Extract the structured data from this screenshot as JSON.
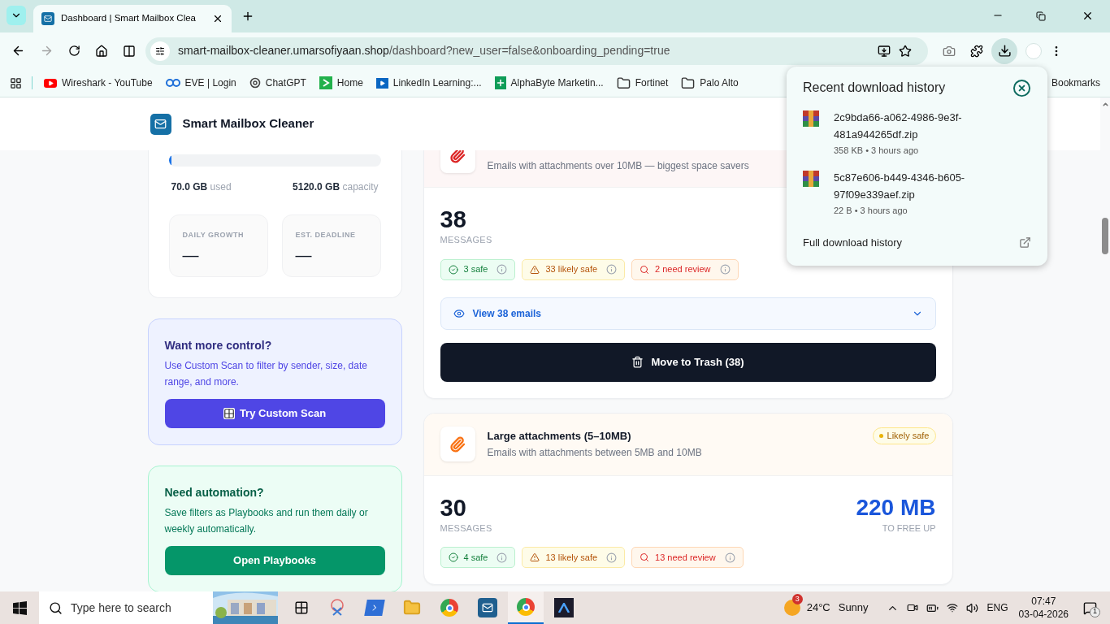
{
  "browser": {
    "tabs": [
      {
        "title": "Dashboard | Smart Mailbox Clea",
        "selected": true
      }
    ],
    "url_host": "smart-mailbox-cleaner.umarsofiyaan.shop",
    "url_path": "/dashboard?new_user=false&onboarding_pending=true",
    "bookmarks": [
      {
        "label": "Wireshark - YouTube",
        "kind": "youtube"
      },
      {
        "label": "EVE | Login",
        "kind": "eve"
      },
      {
        "label": "ChatGPT",
        "kind": "chatgpt"
      },
      {
        "label": "Home",
        "kind": "home"
      },
      {
        "label": "LinkedIn Learning:...",
        "kind": "linkedin"
      },
      {
        "label": "AlphaByte Marketin...",
        "kind": "sheets"
      },
      {
        "label": "Fortinet",
        "kind": "folder"
      },
      {
        "label": "Palo Alto",
        "kind": "folder"
      },
      {
        "label": "Bookmarks",
        "kind": "all"
      }
    ],
    "downloads": {
      "title": "Recent download history",
      "items": [
        {
          "name": "2c9bda66-a062-4986-9e3f-481a944265df.zip",
          "meta": "358 KB • 3 hours ago"
        },
        {
          "name": "5c87e606-b449-4346-b605-97f09e339aef.zip",
          "meta": "22 B • 3 hours ago"
        }
      ],
      "footer": "Full download history"
    }
  },
  "page": {
    "brand": "Smart Mailbox Cleaner",
    "storage": {
      "level": 0.014,
      "used_value": "70.0 GB",
      "used_label": "used",
      "capacity_value": "5120.0 GB",
      "capacity_label": "capacity",
      "stats": [
        {
          "label": "DAILY GROWTH",
          "value": "—"
        },
        {
          "label": "EST. DEADLINE",
          "value": "—"
        }
      ]
    },
    "promos": [
      {
        "kind": "indigo",
        "title": "Want more control?",
        "text": "Use Custom Scan to filter by sender, size, date range, and more.",
        "button": "Try Custom Scan"
      },
      {
        "kind": "green",
        "title": "Need automation?",
        "text": "Save filters as Playbooks and run them daily or weekly automatically.",
        "button": "Open Playbooks"
      }
    ],
    "categories": [
      {
        "color": "#dc2626",
        "description": "Emails with attachments over 10MB — biggest space savers",
        "count": "38",
        "count_label": "MESSAGES",
        "chips": [
          {
            "kind": "safe",
            "label": "3 safe"
          },
          {
            "kind": "likely",
            "label": "33 likely safe"
          },
          {
            "kind": "review",
            "label": "2 need review"
          }
        ],
        "view_label": "View 38 emails",
        "trash_label": "Move to Trash (38)"
      },
      {
        "color": "#f97316",
        "title": "Large attachments (5–10MB)",
        "description": "Emails with attachments between 5MB and 10MB",
        "badge": "Likely safe",
        "count": "30",
        "count_label": "MESSAGES",
        "size": "220 MB",
        "size_label": "TO FREE UP",
        "chips": [
          {
            "kind": "safe",
            "label": "4 safe"
          },
          {
            "kind": "likely",
            "label": "13 likely safe"
          },
          {
            "kind": "review",
            "label": "13 need review"
          }
        ]
      }
    ]
  },
  "taskbar": {
    "search_placeholder": "Type here to search",
    "weather_badge": "3",
    "temperature": "24°C",
    "condition": "Sunny",
    "language": "ENG",
    "time": "07:47",
    "date": "03-04-2026",
    "notifications": "1"
  }
}
